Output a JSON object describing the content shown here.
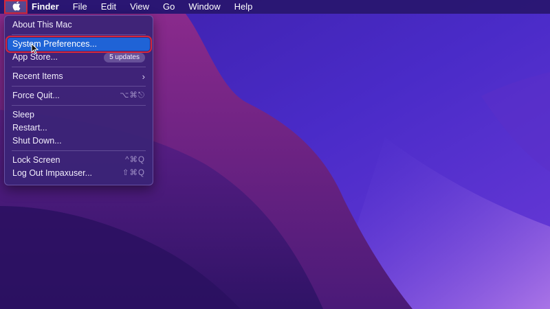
{
  "menubar": {
    "apple_icon": "apple-logo-icon",
    "app_name": "Finder",
    "menus": [
      "File",
      "Edit",
      "View",
      "Go",
      "Window",
      "Help"
    ]
  },
  "apple_menu": {
    "about": "About This Mac",
    "system_preferences": "System Preferences...",
    "app_store": "App Store...",
    "app_store_badge": "5 updates",
    "recent_items": "Recent Items",
    "recent_items_icon": "chevron-right-icon",
    "force_quit": "Force Quit...",
    "force_quit_shortcut": "⌥⌘⎋",
    "sleep": "Sleep",
    "restart": "Restart...",
    "shut_down": "Shut Down...",
    "lock_screen": "Lock Screen",
    "lock_screen_shortcut": "^⌘Q",
    "log_out": "Log Out Impaxuser...",
    "log_out_shortcut": "⇧⌘Q"
  },
  "colors": {
    "highlight": "#1f63d6",
    "annotation_border": "#d6283c",
    "menubar": "#28166e"
  }
}
